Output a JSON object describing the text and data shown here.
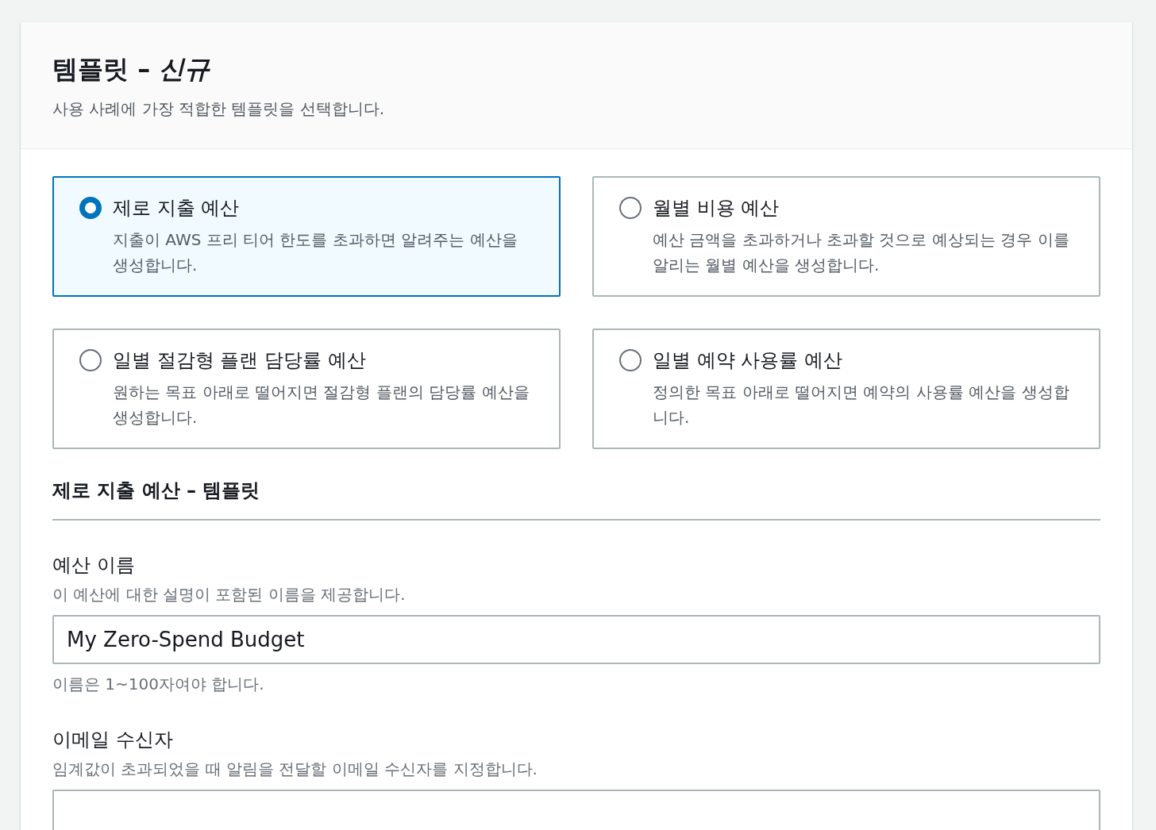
{
  "header": {
    "title": "템플릿 – *신규*",
    "description": "사용 사례에 가장 적합한 템플릿을 선택합니다."
  },
  "templates": [
    {
      "title": "제로 지출 예산",
      "description": "지출이 AWS 프리 티어 한도를 초과하면 알려주는 예산을 생성합니다.",
      "selected": true
    },
    {
      "title": "월별 비용 예산",
      "description": "예산 금액을 초과하거나 초과할 것으로 예상되는 경우 이를 알리는 월별 예산을 생성합니다.",
      "selected": false
    },
    {
      "title": "일별 절감형 플랜 담당률 예산",
      "description": "원하는 목표 아래로 떨어지면 절감형 플랜의 담당률 예산을 생성합니다.",
      "selected": false
    },
    {
      "title": "일별 예약 사용률 예산",
      "description": "정의한 목표 아래로 떨어지면 예약의 사용률 예산을 생성합니다.",
      "selected": false
    }
  ],
  "section": {
    "title": "제로 지출 예산 – 템플릿"
  },
  "fields": [
    {
      "label": "예산 이름",
      "description": "이 예산에 대한 설명이 포함된 이름을 제공합니다.",
      "value": "My Zero-Spend Budget",
      "constraint": "이름은 1~100자여야 합니다."
    },
    {
      "label": "이메일 수신자",
      "description": "임계값이 초과되었을 때 알림을 전달할 이메일 수신자를 지정합니다."
    }
  ]
}
